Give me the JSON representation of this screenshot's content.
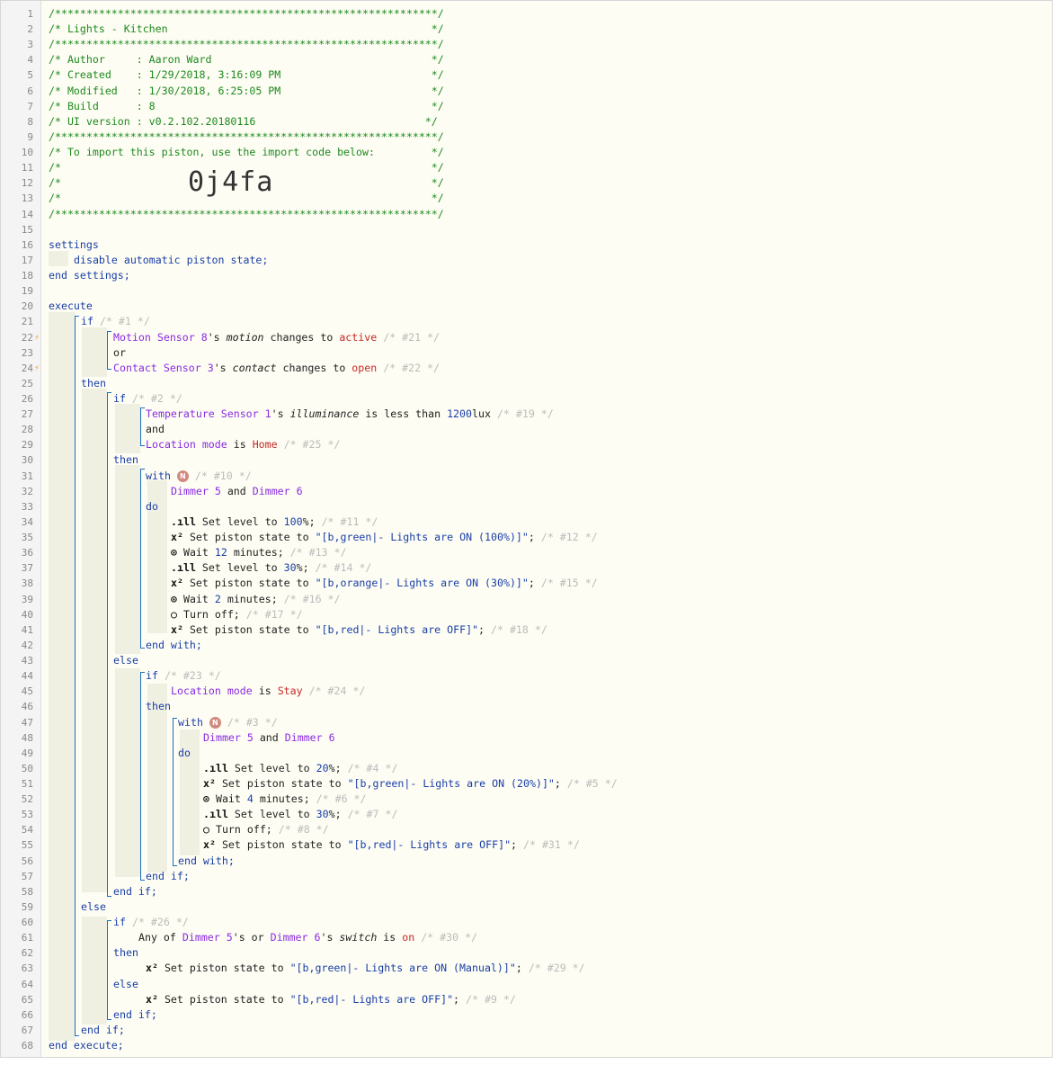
{
  "piston": {
    "name": "Lights - Kitchen",
    "author": "Aaron Ward",
    "created": "1/29/2018, 3:16:09 PM",
    "modified": "1/30/2018, 6:25:05 PM",
    "build": "8",
    "ui_version": "v0.2.102.20180116",
    "import_code": "0j4fa"
  },
  "header": {
    "stars": "/*************************************************************/",
    "title_line": "/* Lights - Kitchen                                          */",
    "author_line": "/* Author     : Aaron Ward                                   */",
    "created_line": "/* Created    : 1/29/2018, 3:16:09 PM                        */",
    "modified_line": "/* Modified   : 1/30/2018, 6:25:05 PM                        */",
    "build_line": "/* Build      : 8                                            */",
    "ui_line": "/* UI version : v0.2.102.20180116                           */",
    "import_line": "/* To import this piston, use the import code below:         */",
    "empty_line": "/*                                                           */"
  },
  "code": {
    "settings": "settings",
    "disable_state": "disable automatic piston state;",
    "end_settings": "end settings;",
    "execute": "execute",
    "end_execute": "end execute;",
    "kw_if": "if",
    "kw_then": "then",
    "kw_else": "else",
    "kw_or": "or",
    "kw_and": "and",
    "kw_with": "with",
    "kw_do": "do",
    "kw_end_if": "end if;",
    "kw_end_with": "end with;",
    "motion_sensor": "Motion Sensor 8",
    "contact_sensor": "Contact Sensor 3",
    "temp_sensor": "Temperature Sensor 1",
    "location_mode": "Location mode",
    "dimmer5": "Dimmer 5",
    "dimmer6": "Dimmer 6",
    "s_possessive": "'s",
    "motion": "motion",
    "contact": "contact",
    "illuminance": "illuminance",
    "switch": "switch",
    "changes_to": "changes to",
    "is": "is",
    "is_less_than": "is less than",
    "active": "active",
    "open": "open",
    "on": "on",
    "home": "Home",
    "stay": "Stay",
    "lux_value": "1200",
    "lux_unit": "lux",
    "any_of": "Any of",
    "or_word": "or",
    "and_word": "and",
    "set_level_to": "Set level to",
    "set_piston_state_to": "Set piston state to",
    "wait": "Wait",
    "minutes": "minutes;",
    "turn_off": "Turn off;",
    "pct_100": "100",
    "pct_30": "30",
    "pct_20": "20",
    "wait_12": "12",
    "wait_2": "2",
    "wait_4": "4",
    "state_green_100": "\"[b,green|- Lights are ON (100%)]\"",
    "state_orange_30": "\"[b,orange|- Lights are ON (30%)]\"",
    "state_red_off": "\"[b,red|- Lights are OFF]\"",
    "state_green_20": "\"[b,green|- Lights are ON (20%)]\"",
    "state_green_manual": "\"[b,green|- Lights are ON (Manual)]\"",
    "c1": "/* #1 */",
    "c2": "/* #2 */",
    "c3": "/* #3 */",
    "c4": "/* #4 */",
    "c5": "/* #5 */",
    "c6": "/* #6 */",
    "c7": "/* #7 */",
    "c8": "/* #8 */",
    "c9": "/* #9 */",
    "c10": "/* #10 */",
    "c11": "/* #11 */",
    "c12": "/* #12 */",
    "c13": "/* #13 */",
    "c14": "/* #14 */",
    "c15": "/* #15 */",
    "c16": "/* #16 */",
    "c17": "/* #17 */",
    "c18": "/* #18 */",
    "c19": "/* #19 */",
    "c21": "/* #21 */",
    "c22": "/* #22 */",
    "c23": "/* #23 */",
    "c24": "/* #24 */",
    "c25": "/* #25 */",
    "c26": "/* #26 */",
    "c29": "/* #29 */",
    "c30": "/* #30 */",
    "c31": "/* #31 */",
    "badge": "N",
    "level_icon": ".ıll",
    "var_icon": "x²",
    "wait_icon": "⊙",
    "off_icon": "○",
    "trigger_icon": "⚡"
  },
  "line_numbers": [
    "1",
    "2",
    "3",
    "4",
    "5",
    "6",
    "7",
    "8",
    "9",
    "10",
    "11",
    "12",
    "13",
    "14",
    "15",
    "16",
    "17",
    "18",
    "19",
    "20",
    "21",
    "22",
    "23",
    "24",
    "25",
    "26",
    "27",
    "28",
    "29",
    "30",
    "31",
    "32",
    "33",
    "34",
    "35",
    "36",
    "37",
    "38",
    "39",
    "40",
    "41",
    "42",
    "43",
    "44",
    "45",
    "46",
    "47",
    "48",
    "49",
    "50",
    "51",
    "52",
    "53",
    "54",
    "55",
    "56",
    "57",
    "58",
    "59",
    "60",
    "61",
    "62",
    "63",
    "64",
    "65",
    "66",
    "67",
    "68"
  ]
}
